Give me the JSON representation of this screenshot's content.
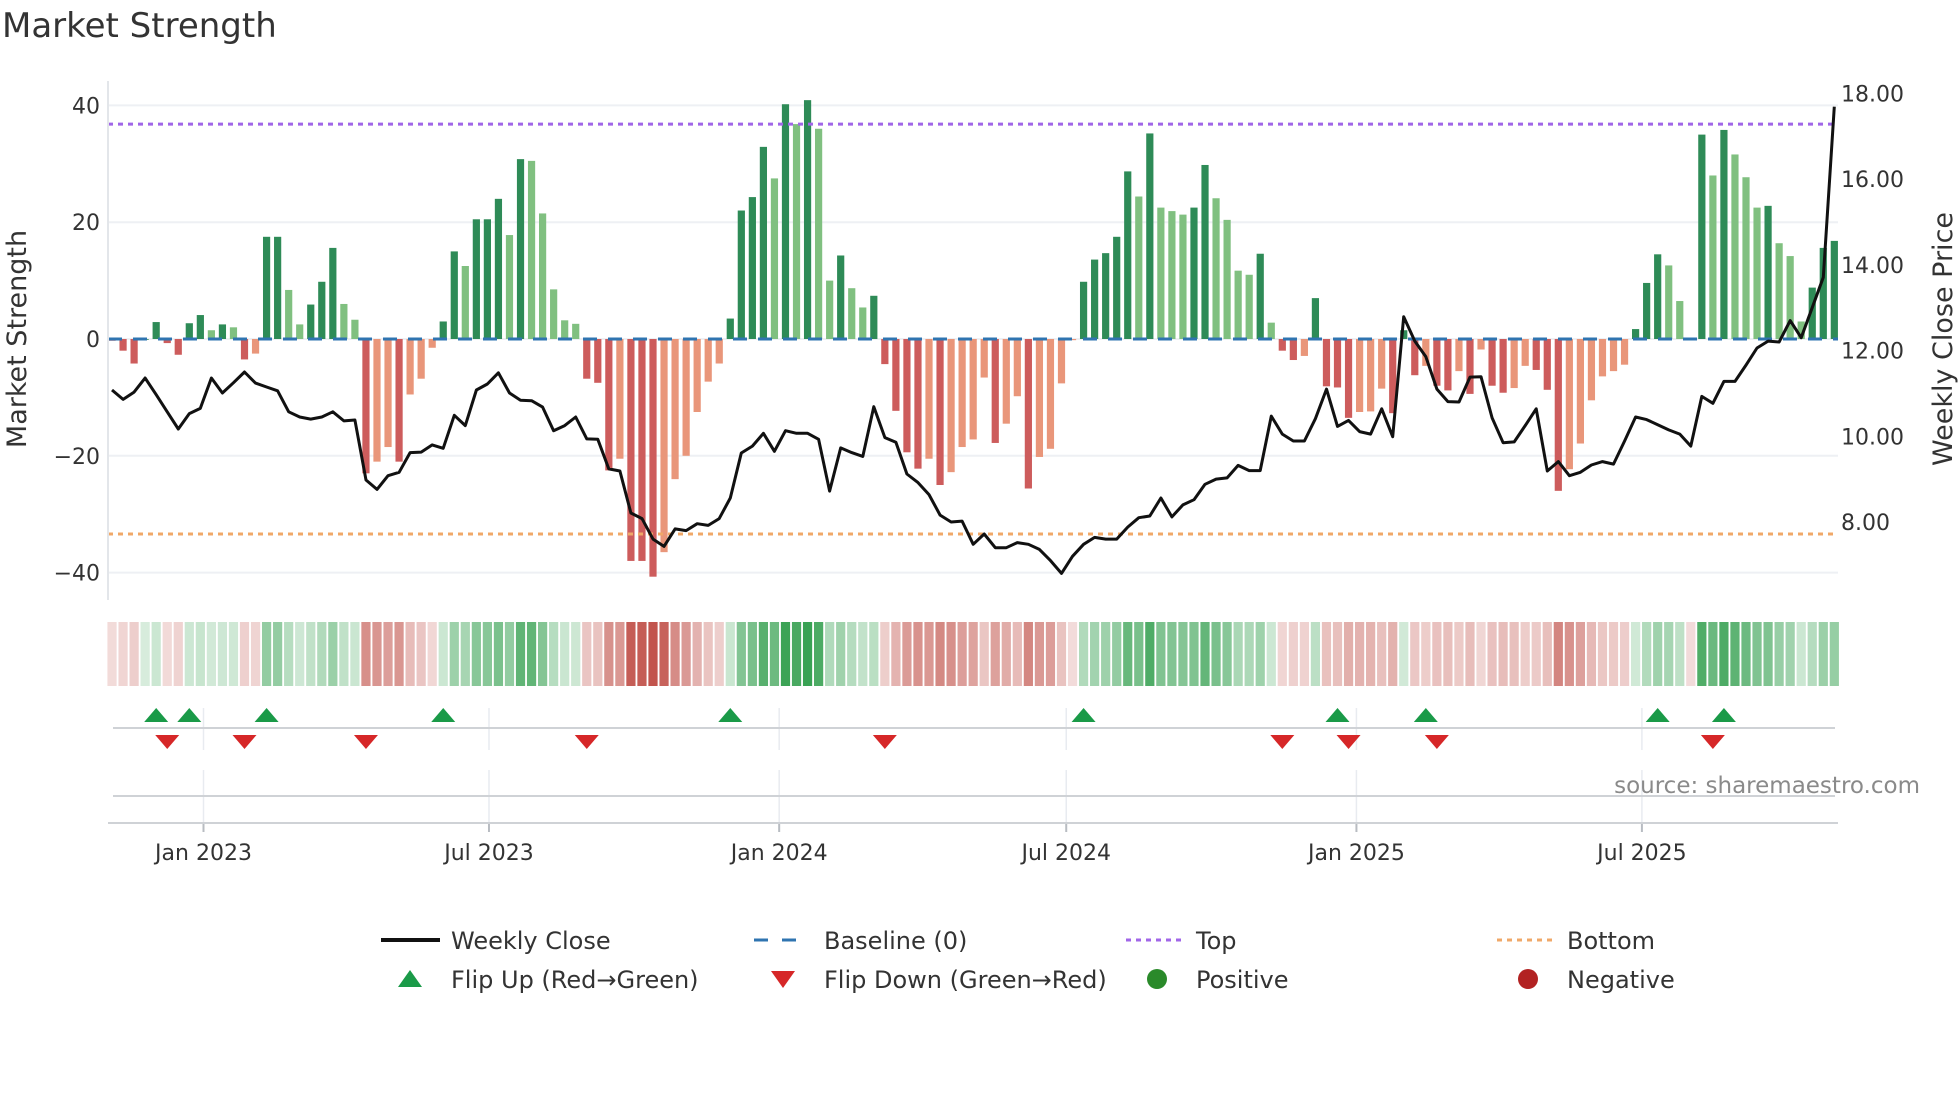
{
  "chart_data": {
    "type": "bar",
    "title": "Market Strength",
    "ylabel": "Market Strength",
    "y2label": "Weekly Close Price",
    "ylim": [
      -44.5,
      44.5
    ],
    "y2lim": [
      6.2,
      18.3
    ],
    "y_ticks": [
      "40",
      "20",
      "0",
      "−20",
      "−40"
    ],
    "y_tick_values": [
      40,
      20,
      0,
      -20,
      -40
    ],
    "y2_ticks": [
      "18.00",
      "16.00",
      "14.00",
      "12.00",
      "10.00",
      "8.00"
    ],
    "y2_tick_values": [
      18,
      16,
      14,
      12,
      10,
      8
    ],
    "x_ticks": [
      {
        "label": "Jan 2023",
        "date": "2023-01-01"
      },
      {
        "label": "Jul 2023",
        "date": "2023-07-01"
      },
      {
        "label": "Jan 2024",
        "date": "2024-01-01"
      },
      {
        "label": "Jul 2024",
        "date": "2024-07-01"
      },
      {
        "label": "Jan 2025",
        "date": "2025-01-01"
      },
      {
        "label": "Jul 2025",
        "date": "2025-07-01"
      }
    ],
    "grid": true,
    "top_level": 36.8,
    "bottom_level": -33.4,
    "baseline": 0,
    "dates": [
      "2022-11-04",
      "2022-11-11",
      "2022-11-18",
      "2022-11-25",
      "2022-12-02",
      "2022-12-09",
      "2022-12-16",
      "2022-12-23",
      "2022-12-30",
      "2023-01-06",
      "2023-01-13",
      "2023-01-20",
      "2023-01-27",
      "2023-02-03",
      "2023-02-10",
      "2023-02-17",
      "2023-02-24",
      "2023-03-03",
      "2023-03-10",
      "2023-03-17",
      "2023-03-24",
      "2023-03-31",
      "2023-04-07",
      "2023-04-14",
      "2023-04-21",
      "2023-04-28",
      "2023-05-05",
      "2023-05-12",
      "2023-05-19",
      "2023-05-26",
      "2023-06-02",
      "2023-06-09",
      "2023-06-16",
      "2023-06-23",
      "2023-06-30",
      "2023-07-07",
      "2023-07-14",
      "2023-07-21",
      "2023-07-28",
      "2023-08-04",
      "2023-08-11",
      "2023-08-18",
      "2023-08-25",
      "2023-09-01",
      "2023-09-08",
      "2023-09-15",
      "2023-09-22",
      "2023-09-29",
      "2023-10-06",
      "2023-10-13",
      "2023-10-20",
      "2023-10-27",
      "2023-11-03",
      "2023-11-10",
      "2023-11-17",
      "2023-11-24",
      "2023-12-01",
      "2023-12-08",
      "2023-12-15",
      "2023-12-22",
      "2023-12-29",
      "2024-01-05",
      "2024-01-12",
      "2024-01-19",
      "2024-01-26",
      "2024-02-02",
      "2024-02-09",
      "2024-02-16",
      "2024-02-23",
      "2024-03-01",
      "2024-03-08",
      "2024-03-15",
      "2024-03-22",
      "2024-03-29",
      "2024-04-05",
      "2024-04-12",
      "2024-04-19",
      "2024-04-26",
      "2024-05-03",
      "2024-05-10",
      "2024-05-17",
      "2024-05-24",
      "2024-05-31",
      "2024-06-07",
      "2024-06-14",
      "2024-06-21",
      "2024-06-28",
      "2024-07-05",
      "2024-07-12",
      "2024-07-19",
      "2024-07-26",
      "2024-08-02",
      "2024-08-09",
      "2024-08-16",
      "2024-08-23",
      "2024-08-30",
      "2024-09-06",
      "2024-09-13",
      "2024-09-20",
      "2024-09-27",
      "2024-10-04",
      "2024-10-11",
      "2024-10-18",
      "2024-10-25",
      "2024-11-01",
      "2024-11-08",
      "2024-11-15",
      "2024-11-22",
      "2024-11-29",
      "2024-12-06",
      "2024-12-13",
      "2024-12-20",
      "2024-12-27",
      "2025-01-03",
      "2025-01-10",
      "2025-01-17",
      "2025-01-24",
      "2025-01-31",
      "2025-02-07",
      "2025-02-14",
      "2025-02-21",
      "2025-02-28",
      "2025-03-07",
      "2025-03-14",
      "2025-03-21",
      "2025-03-28",
      "2025-04-04",
      "2025-04-11",
      "2025-04-18",
      "2025-04-25",
      "2025-05-02",
      "2025-05-09",
      "2025-05-16",
      "2025-05-23",
      "2025-05-30",
      "2025-06-06",
      "2025-06-13",
      "2025-06-20",
      "2025-06-27",
      "2025-07-04",
      "2025-07-11",
      "2025-07-18",
      "2025-07-25",
      "2025-08-01",
      "2025-08-08",
      "2025-08-15",
      "2025-08-22",
      "2025-08-29",
      "2025-09-05",
      "2025-09-12",
      "2025-09-19",
      "2025-09-26",
      "2025-10-03",
      "2025-10-10",
      "2025-10-17",
      "2025-10-24",
      "2025-10-31"
    ],
    "series": [
      {
        "name": "Market Strength",
        "axis": "left",
        "values": [
          -0.3,
          -2,
          -4.2,
          0,
          2.9,
          -0.7,
          -2.7,
          2.7,
          4.1,
          1.5,
          2.5,
          2,
          -3.5,
          -2.5,
          17.5,
          17.5,
          8.4,
          2.5,
          5.9,
          9.8,
          15.6,
          6,
          3.3,
          -23,
          -21,
          -18.5,
          -21,
          -9.5,
          -6.8,
          -1.5,
          3,
          15,
          12.5,
          20.5,
          20.5,
          24,
          17.8,
          30.8,
          30.5,
          21.5,
          8.5,
          3.2,
          2.6,
          -6.8,
          -7.5,
          -22.5,
          -20.5,
          -38,
          -38,
          -40.7,
          -36.5,
          -24,
          -20,
          -12.5,
          -7.3,
          -4.2,
          3.5,
          22,
          24.3,
          32.9,
          27.5,
          40.2,
          36.8,
          40.9,
          36,
          10,
          14.3,
          8.7,
          5.4,
          7.4,
          -4.3,
          -12.3,
          -19.4,
          -22.2,
          -20.5,
          -25,
          -22.8,
          -18.5,
          -17.2,
          -6.6,
          -17.8,
          -14.5,
          -9.8,
          -25.6,
          -20.2,
          -18.8,
          -7.6,
          -0.2,
          9.8,
          13.6,
          14.7,
          17.5,
          28.7,
          24.4,
          35.2,
          22.5,
          21.9,
          21.3,
          22.5,
          29.8,
          24.1,
          20.4,
          11.7,
          11,
          14.6,
          2.8,
          -2,
          -3.6,
          -2.9,
          7,
          -8.1,
          -8.3,
          -13.5,
          -12.5,
          -12.4,
          -8.5,
          -12.7,
          1.5,
          -6.2,
          -4.6,
          -8,
          -8.8,
          -5.5,
          -9.4,
          -1.8,
          -8,
          -9.2,
          -8.4,
          -4.6,
          -5.3,
          -8.7,
          -26,
          -22.3,
          -17.9,
          -10.5,
          -6.4,
          -5.5,
          -4.4,
          1.7,
          9.6,
          14.5,
          12.6,
          6.5,
          -0.2,
          35,
          28,
          35.8,
          31.6,
          27.7,
          22.5,
          22.8,
          16.4,
          14.2,
          3,
          8.8,
          15.6,
          16.8
        ]
      },
      {
        "name": "Weekly Close",
        "axis": "right",
        "values": [
          11.08,
          10.86,
          11.03,
          11.36,
          10.97,
          10.57,
          10.17,
          10.53,
          10.65,
          11.36,
          11.01,
          11.25,
          11.5,
          11.24,
          11.15,
          11.06,
          10.57,
          10.45,
          10.4,
          10.45,
          10.57,
          10.36,
          10.38,
          8.98,
          8.76,
          9.08,
          9.16,
          9.62,
          9.63,
          9.8,
          9.72,
          10.49,
          10.25,
          11.08,
          11.22,
          11.48,
          11.01,
          10.84,
          10.83,
          10.68,
          10.13,
          10.25,
          10.45,
          9.94,
          9.93,
          9.24,
          9.19,
          8.21,
          8.08,
          7.6,
          7.43,
          7.84,
          7.8,
          7.96,
          7.92,
          8.08,
          8.56,
          9.61,
          9.77,
          10.07,
          9.65,
          10.13,
          10.07,
          10.07,
          9.93,
          8.72,
          9.73,
          9.62,
          9.53,
          10.69,
          9.97,
          9.86,
          9.12,
          8.92,
          8.64,
          8.16,
          8.0,
          8.02,
          7.48,
          7.72,
          7.4,
          7.4,
          7.52,
          7.48,
          7.36,
          7.1,
          6.8,
          7.2,
          7.48,
          7.64,
          7.6,
          7.6,
          7.88,
          8.1,
          8.14,
          8.56,
          8.12,
          8.4,
          8.52,
          8.88,
          9.0,
          9.03,
          9.32,
          9.2,
          9.2,
          10.47,
          10.05,
          9.89,
          9.89,
          10.41,
          11.1,
          10.23,
          10.37,
          10.11,
          10.05,
          10.64,
          9.99,
          12.79,
          12.22,
          11.86,
          11.1,
          10.81,
          10.8,
          11.38,
          11.39,
          10.43,
          9.85,
          9.87,
          10.25,
          10.64,
          9.19,
          9.41,
          9.08,
          9.16,
          9.33,
          9.41,
          9.35,
          9.89,
          10.45,
          10.39,
          10.27,
          10.15,
          10.05,
          9.77,
          10.93,
          10.77,
          11.28,
          11.28,
          11.66,
          12.06,
          12.22,
          12.2,
          12.7,
          12.3,
          13.0,
          13.71,
          17.69
        ]
      }
    ],
    "flip_up_dates": [
      "2022-12-02",
      "2022-12-23",
      "2023-02-10",
      "2023-06-02",
      "2023-12-01",
      "2024-07-12",
      "2024-12-20",
      "2025-02-14",
      "2025-07-11",
      "2025-08-22"
    ],
    "flip_down_dates": [
      "2022-12-09",
      "2023-01-27",
      "2023-04-14",
      "2023-09-01",
      "2024-03-08",
      "2024-11-15",
      "2024-12-27",
      "2025-02-21",
      "2025-08-15"
    ],
    "legend": {
      "placement": "bottom",
      "items": [
        {
          "label": "Weekly Close",
          "symbol": "line",
          "color": "#111111"
        },
        {
          "label": "Baseline (0)",
          "symbol": "dash",
          "color": "#2f74b0"
        },
        {
          "label": "Top",
          "symbol": "dot",
          "color": "#a066e8"
        },
        {
          "label": "Bottom",
          "symbol": "dot",
          "color": "#f0a868"
        },
        {
          "label": "Flip Up (Red→Green)",
          "symbol": "triangle-up",
          "color": "#1a9a48"
        },
        {
          "label": "Flip Down (Green→Red)",
          "symbol": "triangle-down",
          "color": "#d62728"
        },
        {
          "label": "Positive",
          "symbol": "circle",
          "color": "#2a8a2a"
        },
        {
          "label": "Negative",
          "symbol": "circle",
          "color": "#b22222"
        }
      ]
    },
    "colors": {
      "rising_green": "#2e8b57",
      "falling_green": "#80c080",
      "falling_red": "#cd5c5c",
      "rising_red": "#e9967a",
      "strip_green": "#35a050",
      "strip_red": "#c05048"
    }
  },
  "source": "source: sharemaestro.com"
}
